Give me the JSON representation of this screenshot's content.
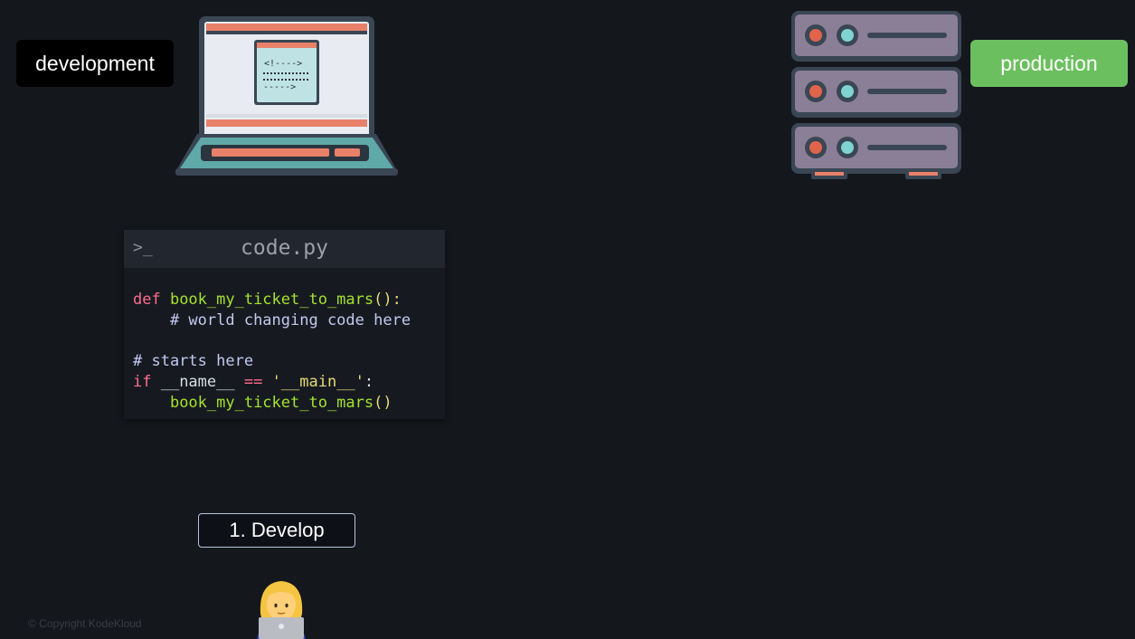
{
  "environments": {
    "development_label": "development",
    "production_label": "production"
  },
  "code_window": {
    "prompt_symbol": ">_",
    "file_name": "code.py",
    "lines": [
      {
        "indent": "",
        "parts": [
          {
            "t": "def ",
            "c": "kw"
          },
          {
            "t": "book_my_ticket_to_mars",
            "c": "fn"
          },
          {
            "t": "():",
            "c": "paren"
          }
        ]
      },
      {
        "indent": "    ",
        "parts": [
          {
            "t": "# world changing code here",
            "c": "cm"
          }
        ]
      },
      {
        "indent": "",
        "parts": []
      },
      {
        "indent": "",
        "parts": [
          {
            "t": "# starts here",
            "c": "cm"
          }
        ]
      },
      {
        "indent": "",
        "parts": [
          {
            "t": "if ",
            "c": "kw"
          },
          {
            "t": "__name__ ",
            "c": "plain"
          },
          {
            "t": "== ",
            "c": "op"
          },
          {
            "t": "'__main__'",
            "c": "str"
          },
          {
            "t": ":",
            "c": "plain"
          }
        ]
      },
      {
        "indent": "    ",
        "parts": [
          {
            "t": "book_my_ticket_to_mars",
            "c": "fn"
          },
          {
            "t": "()",
            "c": "paren"
          }
        ]
      }
    ]
  },
  "step": {
    "label": "1. Develop"
  },
  "footer": {
    "copyright": "© Copyright KodeKloud"
  },
  "icons": {
    "laptop": "laptop-icon",
    "server": "server-rack-icon",
    "developer": "developer-emoji-icon"
  },
  "colors": {
    "background": "#14171c",
    "production_green": "#6cbf5e",
    "laptop_teal": "#5fa9a8",
    "laptop_accent": "#e8806a",
    "server_body": "#8a7f96"
  }
}
